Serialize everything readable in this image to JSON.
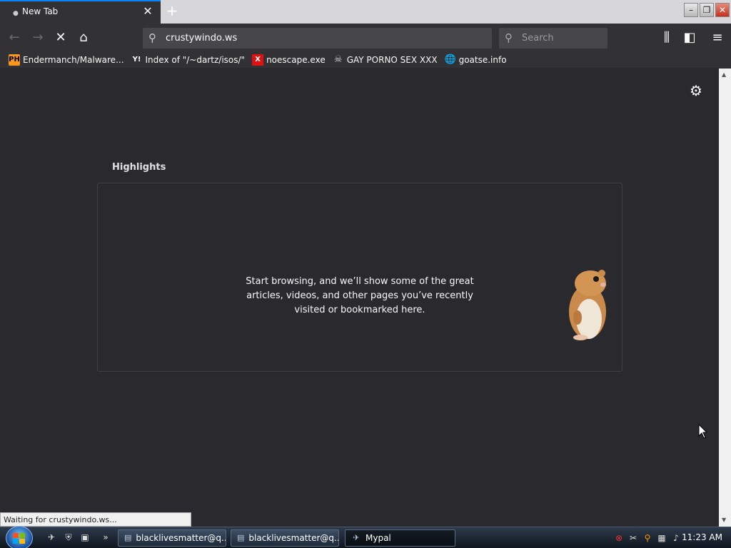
{
  "tab": {
    "title": "New Tab"
  },
  "nav": {
    "url": "crustywindo.ws",
    "search_placeholder": "Search"
  },
  "bookmarks": [
    {
      "label": "Endermanch/Malware...",
      "icon": "ph-icon",
      "icon_text": "PH"
    },
    {
      "label": "Index of \"/~dartz/isos/\"",
      "icon": "yp-icon",
      "icon_text": "Y!"
    },
    {
      "label": "noescape.exe",
      "icon": "x-icon",
      "icon_text": "X"
    },
    {
      "label": "GAY PORNO SEX XXX",
      "icon": "skull-icon",
      "icon_text": "☠"
    },
    {
      "label": "goatse.info",
      "icon": "globe-icon",
      "icon_text": "🌐"
    }
  ],
  "content": {
    "highlights_title": "Highlights",
    "empty_message": "Start browsing, and we’ll show some of the great articles, videos, and other pages you’ve recently visited or bookmarked here."
  },
  "status": {
    "text": "Waiting for crustywindo.ws..."
  },
  "taskbar": {
    "tasks": [
      {
        "label": "blacklivesmatter@q..."
      },
      {
        "label": "blacklivesmatter@q..."
      },
      {
        "label": "Mypal"
      }
    ],
    "clock": "11:23 AM"
  },
  "colors": {
    "accent": "#0a84ff",
    "toolbar": "#323234",
    "content_bg": "#2a2a2e"
  }
}
